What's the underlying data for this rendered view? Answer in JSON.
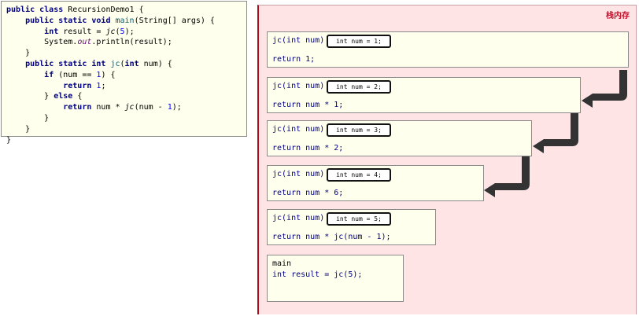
{
  "code": {
    "lines": [
      "public class RecursionDemo1 {",
      "    public static void main(String[] args) {",
      "        int result = jc(5);",
      "        System.out.println(result);",
      "    }",
      "    public static int jc(int num) {",
      "        if (num == 1) {",
      "            return 1;",
      "        } else {",
      "            return num * jc(num - 1);",
      "        }",
      "    }",
      "}"
    ]
  },
  "stack": {
    "title": "栈内存",
    "frames": [
      {
        "head": "jc(int num)",
        "tag": "int num = 1;",
        "body": "return 1;"
      },
      {
        "head": "jc(int num)",
        "tag": "int num = 2;",
        "body": "return num * 1;"
      },
      {
        "head": "jc(int num)",
        "tag": "int num = 3;",
        "body": "return num * 2;"
      },
      {
        "head": "jc(int num)",
        "tag": "int num = 4;",
        "body": "return num * 6;"
      },
      {
        "head": "jc(int num)",
        "tag": "int num = 5;",
        "body": "return num * jc(num - 1);"
      }
    ],
    "main": {
      "head": "main",
      "body": "int result = jc(5);"
    }
  },
  "colors": {
    "stack_bg": "#ffe4e6",
    "stack_border": "#b00a1f",
    "frame_bg": "#ffffee",
    "arrow": "#333333"
  }
}
